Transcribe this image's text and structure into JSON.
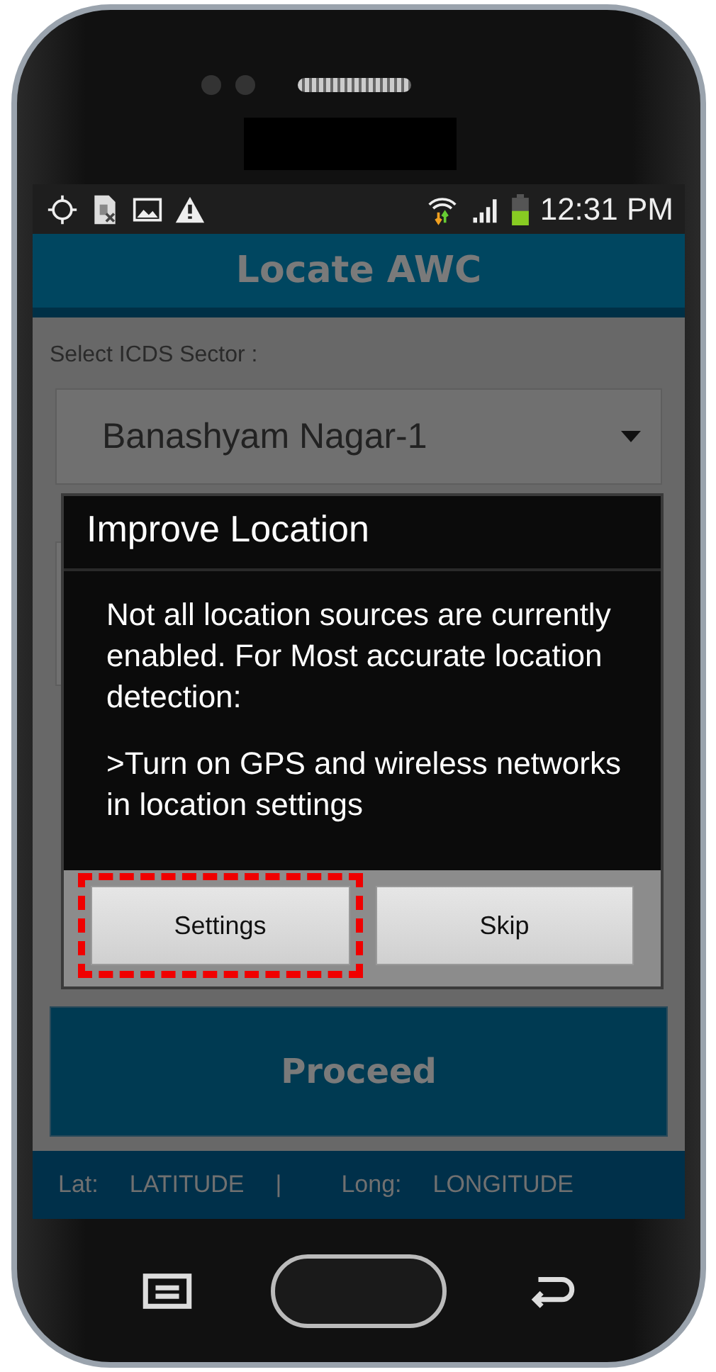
{
  "status_bar": {
    "time": "12:31 PM"
  },
  "app_bar": {
    "title": "Locate AWC"
  },
  "form": {
    "sector_label": "Select ICDS Sector :",
    "sector_value": "Banashyam Nagar-1"
  },
  "proceed_button": "Proceed",
  "footer": {
    "lat_label": "Lat:",
    "lat_value": "LATITUDE",
    "separator": "|",
    "long_label": "Long:",
    "long_value": "LONGITUDE"
  },
  "dialog": {
    "title": "Improve Location",
    "paragraphs": [
      "Not all location sources are currently enabled. For Most accurate location detection:",
      ">Turn on GPS and wireless networks in location settings"
    ],
    "buttons": [
      {
        "label": "Settings",
        "highlighted": true
      },
      {
        "label": "Skip",
        "highlighted": false
      }
    ]
  }
}
